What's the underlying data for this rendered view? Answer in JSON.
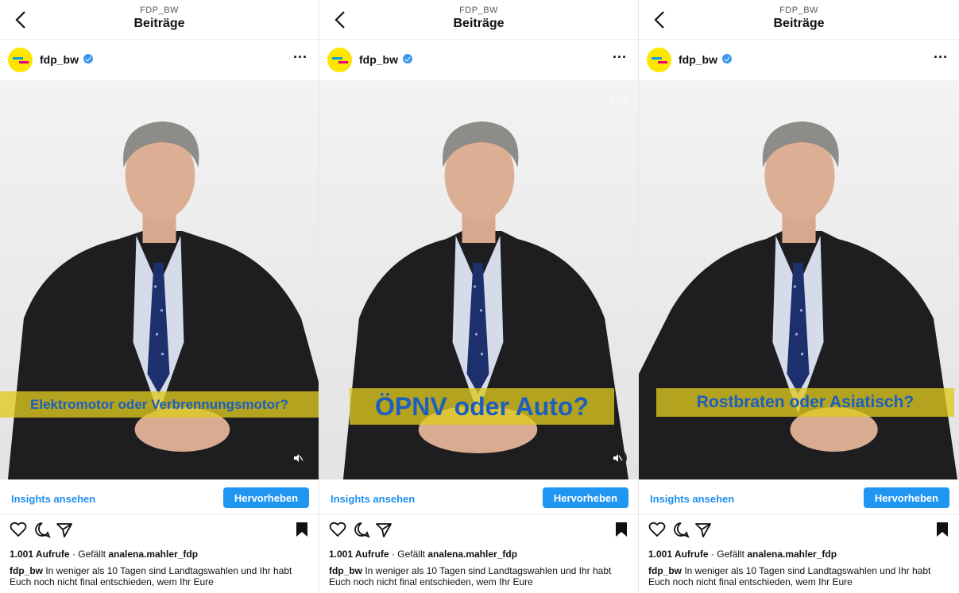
{
  "header": {
    "subtitle": "FDP_BW",
    "title": "Beiträge"
  },
  "account": {
    "handle": "fdp_bw"
  },
  "colors": {
    "accent": "#2096f3",
    "caption_band": "#dec91e",
    "caption_text": "#1d5fbf",
    "brand_yellow": "#ffe600"
  },
  "panels": [
    {
      "caption_overlay": "Elektromotor oder Verbrennungsmotor?",
      "timer": "",
      "insights_label": "Insights ansehen",
      "highlight_label": "Hervorheben",
      "views": "1.001 Aufrufe",
      "separator": "·",
      "liked_prefix": "Gefällt",
      "liked_by": "analena.mahler_fdp",
      "caption_user": "fdp_bw",
      "caption_text": "In weniger als 10 Tagen sind Landtagswahlen und Ihr habt Euch noch nicht final entschieden, wem Ihr Eure"
    },
    {
      "caption_overlay": "ÖPNV oder Auto?",
      "timer": "0:06",
      "insights_label": "Insights ansehen",
      "highlight_label": "Hervorheben",
      "views": "1.001 Aufrufe",
      "separator": "·",
      "liked_prefix": "Gefällt",
      "liked_by": "analena.mahler_fdp",
      "caption_user": "fdp_bw",
      "caption_text": "In weniger als 10 Tagen sind Landtagswahlen und Ihr habt Euch noch nicht final entschieden, wem Ihr Eure"
    },
    {
      "caption_overlay": "Rostbraten oder Asiatisch?",
      "timer": "",
      "insights_label": "Insights ansehen",
      "highlight_label": "Hervorheben",
      "views": "1.001 Aufrufe",
      "separator": "·",
      "liked_prefix": "Gefällt",
      "liked_by": "analena.mahler_fdp",
      "caption_user": "fdp_bw",
      "caption_text": "In weniger als 10 Tagen sind Landtagswahlen und Ihr habt Euch noch nicht final entschieden, wem Ihr Eure"
    }
  ],
  "icons": [
    "back-chevron-icon",
    "verified-badge-icon",
    "more-options-icon",
    "mute-icon",
    "heart-icon",
    "comment-icon",
    "share-icon",
    "bookmark-icon"
  ]
}
